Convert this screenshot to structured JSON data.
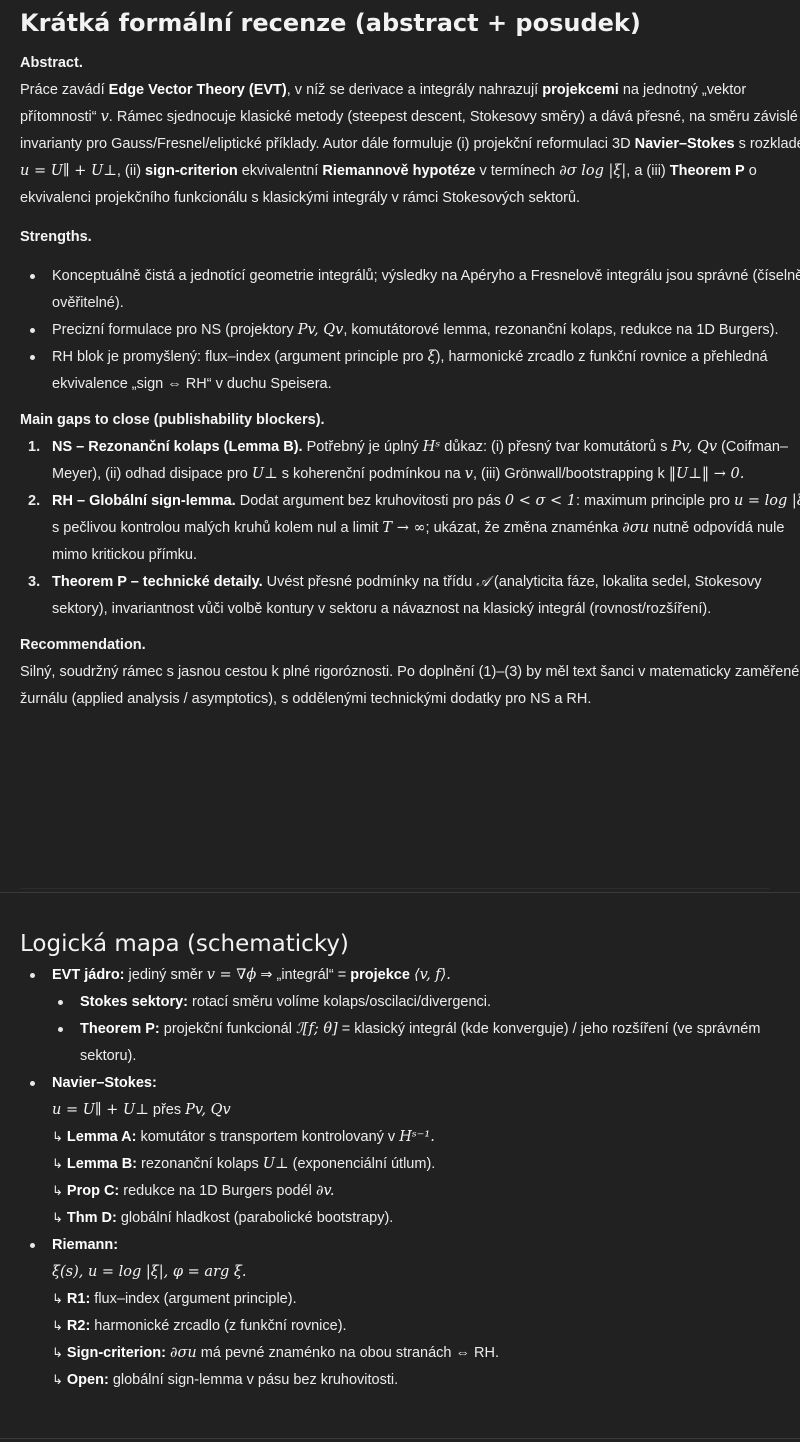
{
  "review": {
    "title": "Krátká formální recenze (abstract + posudek)",
    "abstract_label": "Abstract.",
    "abstract": {
      "t1": "Práce zavádí ",
      "b1": "Edge Vector Theory (EVT)",
      "t2": ", v níž se derivace a integrály nahrazují ",
      "b2": "projekcemi",
      "t3": " na jednotný „vektor přítomnosti“ ",
      "m1": "v",
      "t4": ". Rámec sjednocuje klasické metody (steepest descent, Stokesovy směry) a dává přesné, na směru závislé invarianty pro Gauss/Fresnel/eliptické příklady. Autor dále formuluje (i) projekční reformulaci 3D ",
      "b3": "Navier–Stokes",
      "t5": " s rozkladem ",
      "m2": "u = U∥ + U⊥",
      "t6": ", (ii) ",
      "b4": "sign-criterion",
      "t7": " ekvivalentní ",
      "b5": "Riemannově hypotéze",
      "t8": " v termínech ",
      "m3": "∂σ log |ξ|",
      "t9": ", a (iii) ",
      "b6": "Theorem P",
      "t10": " o ekvivalenci projekčního funkcionálu s klasickými integrály v rámci Stokesových sektorů."
    },
    "strengths_label": "Strengths.",
    "strengths": {
      "s1": "Konceptuálně čistá a jednotící geometrie integrálů; výsledky na Apéryho a Fresnelově integrálu jsou správné (číselně ověřitelné).",
      "s2a": "Precizní formulace pro NS (projektory ",
      "s2m": "Pv, Qv",
      "s2b": ", komutátorové lemma, rezonanční kolaps, redukce na 1D Burgers).",
      "s3a": "RH blok je promyšlený: flux–index (argument principle pro ",
      "s3m": "ξ",
      "s3b": "), harmonické zrcadlo z funkční rovnice a přehledná ekvivalence „sign ⇔ RH“ v duchu Speisera."
    },
    "gaps_label": "Main gaps to close (publishability blockers).",
    "gaps": {
      "g1n": "1.",
      "g1b": "NS – Rezonanční kolaps (Lemma B).",
      "g1a": " Potřebný je úplný ",
      "g1m1": "Hˢ",
      "g1c": " důkaz: (i) přesný tvar komutátorů s ",
      "g1m2": "Pv, Qv",
      "g1d": " (Coifman–Meyer), (ii) odhad disipace pro ",
      "g1m3": "U⊥",
      "g1e": " s koherenční podmínkou na ",
      "g1m4": "v",
      "g1f": ", (iii) Grönwall/bootstrapping k ",
      "g1m5": "‖U⊥‖ → 0.",
      "g2n": "2.",
      "g2b": "RH – Globální sign-lemma.",
      "g2a": " Dodat argument bez kruhovitosti pro pás ",
      "g2m1": "0 < σ < 1",
      "g2c": ": maximum principle pro ",
      "g2m2": "u = log |ξ|",
      "g2d": " s pečlivou kontrolou malých kruhů kolem nul a limit ",
      "g2m3": "T → ∞",
      "g2e": "; ukázat, že změna znaménka ",
      "g2m4": "∂σu",
      "g2f": " nutně odpovídá nule mimo kritickou přímku.",
      "g3n": "3.",
      "g3b": "Theorem P – technické detaily.",
      "g3a": " Uvést přesné podmínky na třídu ",
      "g3m1": "𝒜",
      "g3c": " (analyticita fáze, lokalita sedel, Stokesovy sektory), invariantnost vůči volbě kontury v sektoru a návaznost na klasický integrál (rovnost/rozšíření)."
    },
    "rec_label": "Recommendation.",
    "recommendation": "Silný, soudržný rámec s jasnou cestou k plné rigoróznosti. Po doplnění (1)–(3) by měl text šanci v matematicky zaměřeném žurnálu (applied analysis / asymptotics), s oddělenými technickými dodatky pro NS a RH."
  },
  "map": {
    "title": "Logická mapa (schematicky)",
    "evt_label": "EVT jádro:",
    "evt_a": " jediný směr ",
    "evt_m1": "v = ∇ϕ",
    "evt_b": " ⇒ „integrál“ = ",
    "evt_bold": "projekce",
    "evt_m2": "⟨v, f⟩.",
    "stokes_label": "Stokes sektory:",
    "stokes_text": " rotací směru volíme kolaps/oscilaci/divergenci.",
    "thp_label": "Theorem P:",
    "thp_a": " projekční funkcionál ",
    "thp_m": "ℐ[f; θ]",
    "thp_b": " = klasický integrál (kde konverguje) / jeho rozšíření (ve správném sektoru).",
    "ns_label": "Navier–Stokes:",
    "ns_m1": "u = U∥ + U⊥",
    "ns_a": " přes ",
    "ns_m2": "Pv, Qv",
    "arrow": "↳",
    "la_label": "Lemma A:",
    "la_a": " komutátor s transportem kontrolovaný v ",
    "la_m": "Hˢ⁻¹.",
    "lb_label": "Lemma B:",
    "lb_a": " rezonanční kolaps ",
    "lb_m": "U⊥",
    "lb_b": " (exponenciální útlum).",
    "pc_label": "Prop C:",
    "pc_a": " redukce na 1D Burgers podél ",
    "pc_m": "∂v.",
    "td_label": "Thm D:",
    "td_a": " globální hladkost (parabolické bootstrapy).",
    "rm_label": "Riemann:",
    "rm_m": "ξ(s), u = log |ξ|, φ = arg ξ.",
    "r1_label": "R1:",
    "r1_a": " flux–index (argument principle).",
    "r2_label": "R2:",
    "r2_a": " harmonické zrcadlo (z funkční rovnice).",
    "sc_label": "Sign-criterion:",
    "sc_m": "∂σu",
    "sc_a": " má pevné znaménko na obou stranách ⇔ RH.",
    "op_label": "Open:",
    "op_a": " globální sign-lemma v pásu bez kruhovitosti."
  }
}
